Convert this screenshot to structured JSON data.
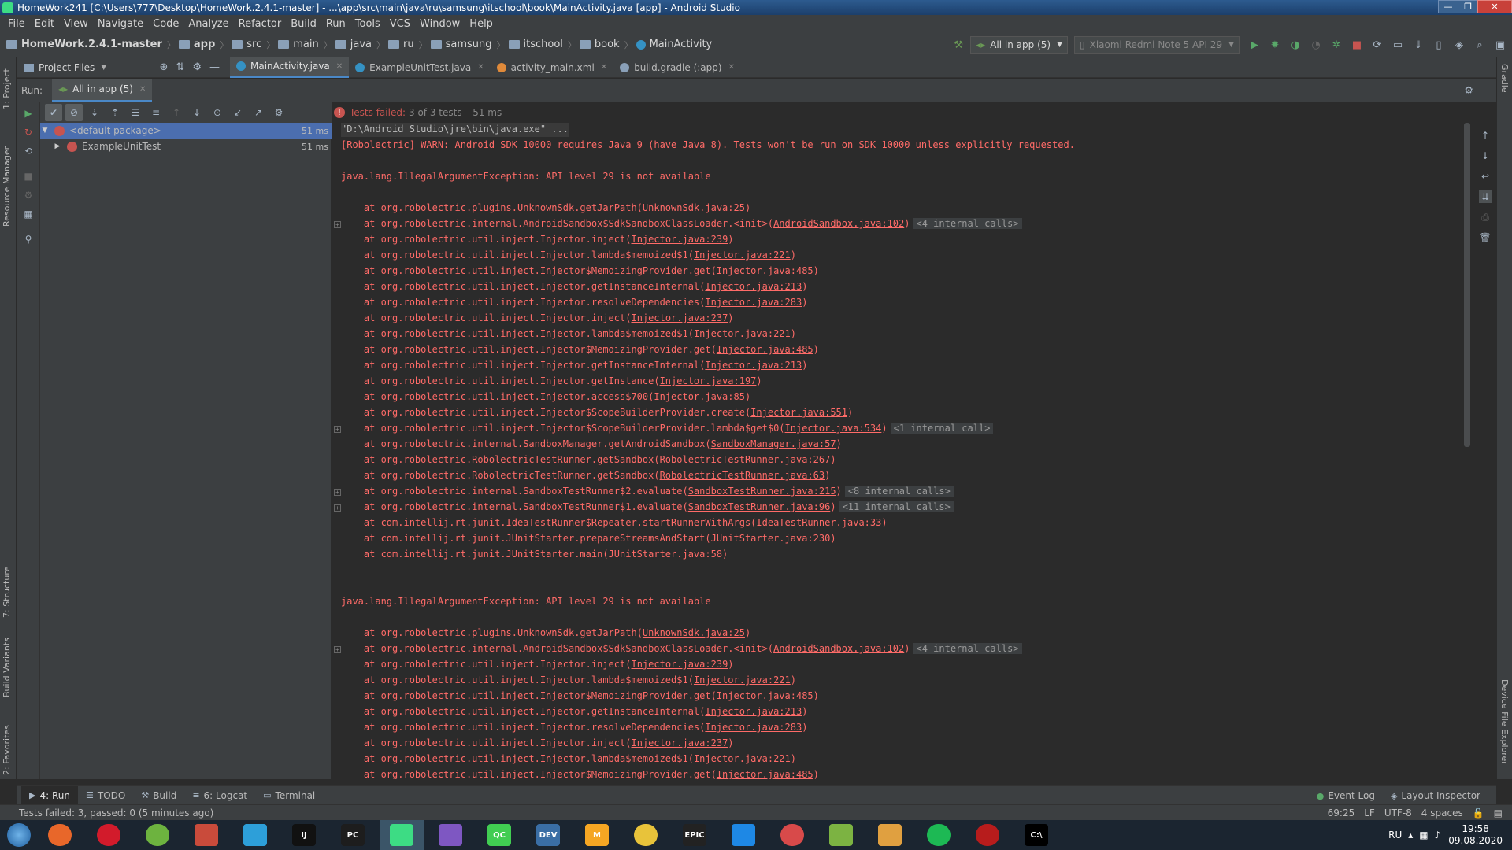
{
  "window": {
    "title": "HomeWork241 [C:\\Users\\777\\Desktop\\HomeWork.2.4.1-master] - ...\\app\\src\\main\\java\\ru\\samsung\\itschool\\book\\MainActivity.java [app] - Android Studio",
    "controls": [
      "—",
      "❐",
      "✕"
    ]
  },
  "menu": [
    "File",
    "Edit",
    "View",
    "Navigate",
    "Code",
    "Analyze",
    "Refactor",
    "Build",
    "Run",
    "Tools",
    "VCS",
    "Window",
    "Help"
  ],
  "breadcrumbs": [
    "HomeWork.2.4.1-master",
    "app",
    "src",
    "main",
    "java",
    "ru",
    "samsung",
    "itschool",
    "book",
    "MainActivity"
  ],
  "toolbar": {
    "run_config": "All in app (5)",
    "device": "Xiaomi Redmi Note 5 API 29"
  },
  "project_panel": {
    "label": "Project Files"
  },
  "editor_tabs": [
    {
      "label": "MainActivity.java",
      "active": true,
      "color": "#3592c4"
    },
    {
      "label": "ExampleUnitTest.java",
      "active": false,
      "color": "#3592c4"
    },
    {
      "label": "activity_main.xml",
      "active": false,
      "color": "#e08a3a"
    },
    {
      "label": "build.gradle (:app)",
      "active": false,
      "color": "#8aa0b8"
    }
  ],
  "run_panel": {
    "label": "Run:",
    "tab": "All in app (5)",
    "status_fail": "Tests failed:",
    "status_rest": "3 of 3 tests – 51 ms"
  },
  "test_tree": [
    {
      "label": "<default package>",
      "time": "51 ms",
      "selected": true
    },
    {
      "label": "ExampleUnitTest",
      "time": "51 ms",
      "selected": false
    }
  ],
  "console": [
    {
      "t": "cmd",
      "text": "\"D:\\Android Studio\\jre\\bin\\java.exe\" ..."
    },
    {
      "t": "err",
      "text": "[Robolectric] WARN: Android SDK 10000 requires Java 9 (have Java 8). Tests won't be run on SDK 10000 unless explicitly requested."
    },
    {
      "t": "blank"
    },
    {
      "t": "err",
      "text": "java.lang.IllegalArgumentException: API level 29 is not available"
    },
    {
      "t": "blank"
    },
    {
      "t": "frame",
      "pre": "    at org.robolectric.plugins.UnknownSdk.getJarPath(",
      "link": "UnknownSdk.java:25",
      "post": ")"
    },
    {
      "t": "frame",
      "pre": "    at org.robolectric.internal.AndroidSandbox$SdkSandboxClassLoader.<init>(",
      "link": "AndroidSandbox.java:102",
      "post": ")",
      "internal": "<4 internal calls>",
      "fold": true
    },
    {
      "t": "frame",
      "pre": "    at org.robolectric.util.inject.Injector.inject(",
      "link": "Injector.java:239",
      "post": ")"
    },
    {
      "t": "frame",
      "pre": "    at org.robolectric.util.inject.Injector.lambda$memoized$1(",
      "link": "Injector.java:221",
      "post": ")"
    },
    {
      "t": "frame",
      "pre": "    at org.robolectric.util.inject.Injector$MemoizingProvider.get(",
      "link": "Injector.java:485",
      "post": ")"
    },
    {
      "t": "frame",
      "pre": "    at org.robolectric.util.inject.Injector.getInstanceInternal(",
      "link": "Injector.java:213",
      "post": ")"
    },
    {
      "t": "frame",
      "pre": "    at org.robolectric.util.inject.Injector.resolveDependencies(",
      "link": "Injector.java:283",
      "post": ")"
    },
    {
      "t": "frame",
      "pre": "    at org.robolectric.util.inject.Injector.inject(",
      "link": "Injector.java:237",
      "post": ")"
    },
    {
      "t": "frame",
      "pre": "    at org.robolectric.util.inject.Injector.lambda$memoized$1(",
      "link": "Injector.java:221",
      "post": ")"
    },
    {
      "t": "frame",
      "pre": "    at org.robolectric.util.inject.Injector$MemoizingProvider.get(",
      "link": "Injector.java:485",
      "post": ")"
    },
    {
      "t": "frame",
      "pre": "    at org.robolectric.util.inject.Injector.getInstanceInternal(",
      "link": "Injector.java:213",
      "post": ")"
    },
    {
      "t": "frame",
      "pre": "    at org.robolectric.util.inject.Injector.getInstance(",
      "link": "Injector.java:197",
      "post": ")"
    },
    {
      "t": "frame",
      "pre": "    at org.robolectric.util.inject.Injector.access$700(",
      "link": "Injector.java:85",
      "post": ")"
    },
    {
      "t": "frame",
      "pre": "    at org.robolectric.util.inject.Injector$ScopeBuilderProvider.create(",
      "link": "Injector.java:551",
      "post": ")"
    },
    {
      "t": "frame",
      "pre": "    at org.robolectric.util.inject.Injector$ScopeBuilderProvider.lambda$get$0(",
      "link": "Injector.java:534",
      "post": ")",
      "internal": "<1 internal call>",
      "fold": true
    },
    {
      "t": "frame",
      "pre": "    at org.robolectric.internal.SandboxManager.getAndroidSandbox(",
      "link": "SandboxManager.java:57",
      "post": ")"
    },
    {
      "t": "frame",
      "pre": "    at org.robolectric.RobolectricTestRunner.getSandbox(",
      "link": "RobolectricTestRunner.java:267",
      "post": ")"
    },
    {
      "t": "frame",
      "pre": "    at org.robolectric.RobolectricTestRunner.getSandbox(",
      "link": "RobolectricTestRunner.java:63",
      "post": ")"
    },
    {
      "t": "frame",
      "pre": "    at org.robolectric.internal.SandboxTestRunner$2.evaluate(",
      "link": "SandboxTestRunner.java:215",
      "post": ")",
      "internal": "<8 internal calls>",
      "fold": true
    },
    {
      "t": "frame",
      "pre": "    at org.robolectric.internal.SandboxTestRunner$1.evaluate(",
      "link": "SandboxTestRunner.java:96",
      "post": ")",
      "internal": "<11 internal calls>",
      "fold": true
    },
    {
      "t": "err",
      "text": "    at com.intellij.rt.junit.IdeaTestRunner$Repeater.startRunnerWithArgs(IdeaTestRunner.java:33)"
    },
    {
      "t": "err",
      "text": "    at com.intellij.rt.junit.JUnitStarter.prepareStreamsAndStart(JUnitStarter.java:230)"
    },
    {
      "t": "err",
      "text": "    at com.intellij.rt.junit.JUnitStarter.main(JUnitStarter.java:58)"
    },
    {
      "t": "blank"
    },
    {
      "t": "blank"
    },
    {
      "t": "err",
      "text": "java.lang.IllegalArgumentException: API level 29 is not available"
    },
    {
      "t": "blank"
    },
    {
      "t": "frame",
      "pre": "    at org.robolectric.plugins.UnknownSdk.getJarPath(",
      "link": "UnknownSdk.java:25",
      "post": ")"
    },
    {
      "t": "frame",
      "pre": "    at org.robolectric.internal.AndroidSandbox$SdkSandboxClassLoader.<init>(",
      "link": "AndroidSandbox.java:102",
      "post": ")",
      "internal": "<4 internal calls>",
      "fold": true
    },
    {
      "t": "frame",
      "pre": "    at org.robolectric.util.inject.Injector.inject(",
      "link": "Injector.java:239",
      "post": ")"
    },
    {
      "t": "frame",
      "pre": "    at org.robolectric.util.inject.Injector.lambda$memoized$1(",
      "link": "Injector.java:221",
      "post": ")"
    },
    {
      "t": "frame",
      "pre": "    at org.robolectric.util.inject.Injector$MemoizingProvider.get(",
      "link": "Injector.java:485",
      "post": ")"
    },
    {
      "t": "frame",
      "pre": "    at org.robolectric.util.inject.Injector.getInstanceInternal(",
      "link": "Injector.java:213",
      "post": ")"
    },
    {
      "t": "frame",
      "pre": "    at org.robolectric.util.inject.Injector.resolveDependencies(",
      "link": "Injector.java:283",
      "post": ")"
    },
    {
      "t": "frame",
      "pre": "    at org.robolectric.util.inject.Injector.inject(",
      "link": "Injector.java:237",
      "post": ")"
    },
    {
      "t": "frame",
      "pre": "    at org.robolectric.util.inject.Injector.lambda$memoized$1(",
      "link": "Injector.java:221",
      "post": ")"
    },
    {
      "t": "frame",
      "pre": "    at org.robolectric.util.inject.Injector$MemoizingProvider.get(",
      "link": "Injector.java:485",
      "post": ")"
    }
  ],
  "side_tools": {
    "left_top": [
      "1: Project",
      "Resource Manager"
    ],
    "left_bottom": [
      "7: Structure",
      "Build Variants",
      "2: Favorites"
    ],
    "right": [
      "Gradle",
      "Device File Explorer"
    ]
  },
  "bottom_tabs": [
    {
      "label": "4: Run",
      "icon": "▶",
      "active": true
    },
    {
      "label": "TODO",
      "icon": "☰",
      "active": false
    },
    {
      "label": "Build",
      "icon": "⚒",
      "active": false
    },
    {
      "label": "6: Logcat",
      "icon": "≡",
      "active": false
    },
    {
      "label": "Terminal",
      "icon": "▭",
      "active": false
    }
  ],
  "bottom_right": [
    "Event Log",
    "Layout Inspector"
  ],
  "statusbar": {
    "message": "Tests failed: 3, passed: 0 (5 minutes ago)",
    "position": "69:25",
    "line_sep": "LF",
    "encoding": "UTF-8",
    "indent": "4 spaces"
  },
  "taskbar": {
    "apps": [
      {
        "name": "firefox",
        "color": "#e8672a",
        "label": ""
      },
      {
        "name": "opera",
        "color": "#d21b2b",
        "label": ""
      },
      {
        "name": "utorrent",
        "color": "#6db33f",
        "label": ""
      },
      {
        "name": "ccleaner",
        "color": "#c94b3b",
        "label": ""
      },
      {
        "name": "telegram",
        "color": "#2d9fd9",
        "label": ""
      },
      {
        "name": "intellij",
        "color": "#111111",
        "label": "IJ"
      },
      {
        "name": "pycharm",
        "color": "#1d1d1d",
        "label": "PC"
      },
      {
        "name": "android-studio",
        "color": "#3ddc84",
        "label": ""
      },
      {
        "name": "visual-studio",
        "color": "#7e57c2",
        "label": ""
      },
      {
        "name": "qt-creator",
        "color": "#41cd52",
        "label": "QC"
      },
      {
        "name": "dev-cpp",
        "color": "#3a6ea5",
        "label": "DEV"
      },
      {
        "name": "mi-app",
        "color": "#f5a623",
        "label": "M"
      },
      {
        "name": "chrome",
        "color": "#e8c33a",
        "label": ""
      },
      {
        "name": "epic-games",
        "color": "#222222",
        "label": "EPIC"
      },
      {
        "name": "skype-app",
        "color": "#1e88e5",
        "label": ""
      },
      {
        "name": "paint",
        "color": "#d84a4a",
        "label": ""
      },
      {
        "name": "android-app",
        "color": "#7cb342",
        "label": ""
      },
      {
        "name": "photos",
        "color": "#e0a040",
        "label": ""
      },
      {
        "name": "spotify",
        "color": "#1db954",
        "label": ""
      },
      {
        "name": "obs",
        "color": "#b71c1c",
        "label": ""
      },
      {
        "name": "cmd",
        "color": "#000000",
        "label": "C:\\"
      }
    ],
    "lang": "RU",
    "time": "19:58",
    "date": "09.08.2020"
  }
}
